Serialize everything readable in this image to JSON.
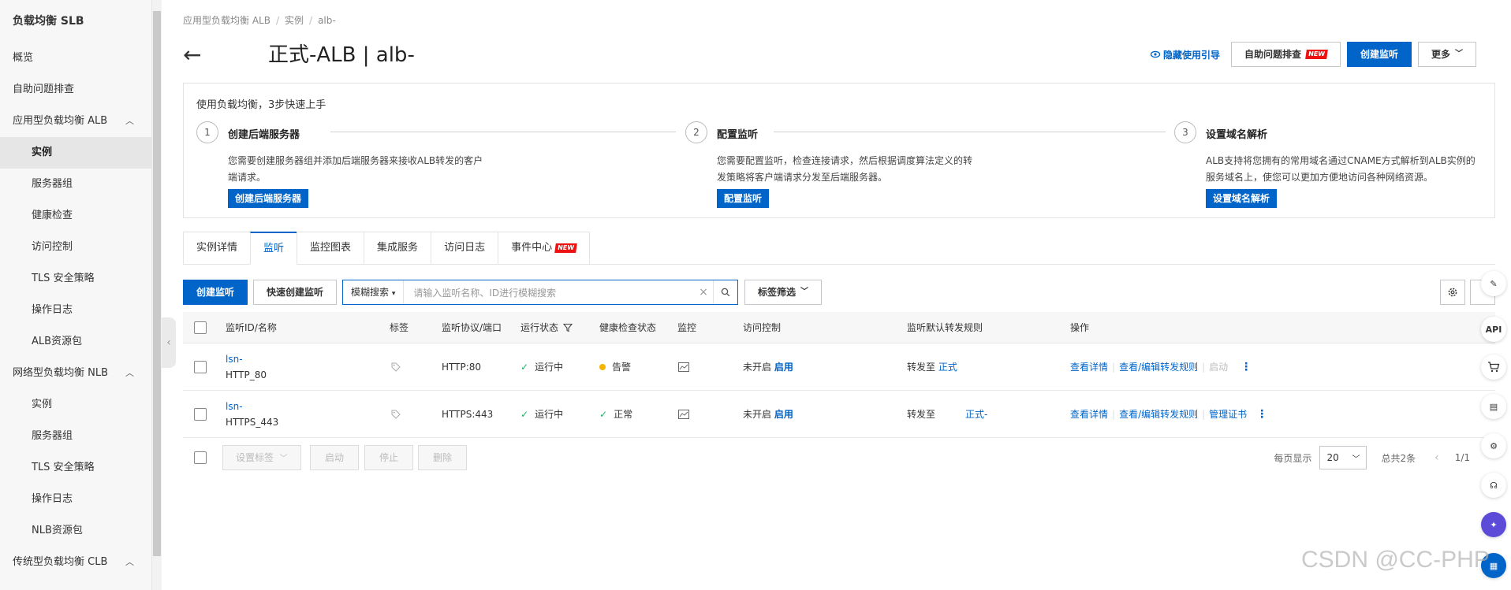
{
  "sidebar": {
    "title": "负载均衡 SLB",
    "items": [
      {
        "label": "概览"
      },
      {
        "label": "自助问题排查"
      },
      {
        "label": "应用型负载均衡 ALB"
      },
      {
        "label": "实例"
      },
      {
        "label": "服务器组"
      },
      {
        "label": "健康检查"
      },
      {
        "label": "访问控制"
      },
      {
        "label": "TLS 安全策略"
      },
      {
        "label": "操作日志"
      },
      {
        "label": "ALB资源包"
      },
      {
        "label": "网络型负载均衡 NLB"
      },
      {
        "label": "实例"
      },
      {
        "label": "服务器组"
      },
      {
        "label": "TLS 安全策略"
      },
      {
        "label": "操作日志"
      },
      {
        "label": "NLB资源包"
      },
      {
        "label": "传统型负载均衡 CLB"
      }
    ]
  },
  "breadcrumb": [
    "应用型负载均衡 ALB",
    "实例",
    "alb-"
  ],
  "page_title": "正式-ALB | alb-",
  "header_actions": {
    "guide_link": "隐藏使用引导",
    "troubleshoot": "自助问题排查",
    "new_badge": "NEW",
    "create_listener": "创建监听",
    "more": "更多"
  },
  "guide": {
    "heading": "使用负载均衡，3步快速上手",
    "steps": [
      {
        "num": "1",
        "title": "创建后端服务器",
        "desc": "您需要创建服务器组并添加后端服务器来接收ALB转发的客户端请求。",
        "button": "创建后端服务器"
      },
      {
        "num": "2",
        "title": "配置监听",
        "desc": "您需要配置监听，检查连接请求，然后根据调度算法定义的转发策略将客户端请求分发至后端服务器。",
        "button": "配置监听"
      },
      {
        "num": "3",
        "title": "设置域名解析",
        "desc": "ALB支持将您拥有的常用域名通过CNAME方式解析到ALB实例的服务域名上，使您可以更加方便地访问各种网络资源。",
        "button": "设置域名解析"
      }
    ]
  },
  "tabs": [
    {
      "label": "实例详情"
    },
    {
      "label": "监听"
    },
    {
      "label": "监控图表"
    },
    {
      "label": "集成服务"
    },
    {
      "label": "访问日志"
    },
    {
      "label": "事件中心",
      "badge": "NEW"
    }
  ],
  "toolbar": {
    "create": "创建监听",
    "quick_create": "快速创建监听",
    "search_mode": "模糊搜索",
    "search_placeholder": "请输入监听名称、ID进行模糊搜索",
    "tag_filter": "标签筛选"
  },
  "table": {
    "headers": [
      "监听ID/名称",
      "标签",
      "监听协议/端口",
      "运行状态",
      "健康检查状态",
      "监控",
      "访问控制",
      "监听默认转发规则",
      "操作"
    ],
    "rows": [
      {
        "id": "lsn-",
        "name": "HTTP_80",
        "proto": "HTTP:80",
        "status": "运行中",
        "health": "告警",
        "acl": "未开启",
        "acl_action": "启用",
        "forward_prefix": "转发至",
        "forward_target": "正式",
        "op1": "查看详情",
        "op2": "查看/编辑转发规则",
        "op3": "启动"
      },
      {
        "id": "lsn-",
        "name": "HTTPS_443",
        "proto": "HTTPS:443",
        "status": "运行中",
        "health": "正常",
        "acl": "未开启",
        "acl_action": "启用",
        "forward_prefix": "转发至",
        "forward_target": "正式-",
        "op1": "查看详情",
        "op2": "查看/编辑转发规则",
        "op3": "管理证书"
      }
    ]
  },
  "footer": {
    "set_tag": "设置标签",
    "start": "启动",
    "stop": "停止",
    "delete": "删除",
    "per_page_label": "每页显示",
    "per_page": "20",
    "total": "总共2条",
    "page": "1/1"
  },
  "right_bar": {
    "api": "API"
  },
  "watermark": "CSDN @CC-PHP",
  "colors": {
    "primary": "#0064c8",
    "new_badge": "#ee1111",
    "ok": "#23b066",
    "warn": "#f5b400"
  }
}
